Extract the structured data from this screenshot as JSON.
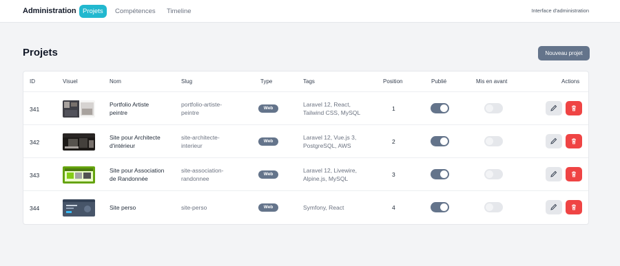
{
  "nav": {
    "brand": "Administration",
    "links": [
      "Projets",
      "Compétences",
      "Timeline"
    ],
    "right_label": "Interface d'administration"
  },
  "page": {
    "title": "Projets",
    "new_button": "Nouveau projet"
  },
  "colors": {
    "accent": "#22b8cf",
    "slate": "#64748b",
    "danger": "#ef4444"
  },
  "table": {
    "headers": [
      "ID",
      "Visuel",
      "Nom",
      "Slug",
      "Type",
      "Tags",
      "Position",
      "Publié",
      "Mis en avant",
      "Actions"
    ],
    "rows": [
      {
        "id": "341",
        "name": [
          "Portfolio Artiste",
          "peintre"
        ],
        "slug": [
          "portfolio-artiste-",
          "peintre"
        ],
        "type": "Web",
        "tags": [
          "Laravel 12, React,",
          "Tailwind CSS, MySQL"
        ],
        "position": "1",
        "published": true,
        "featured": false,
        "thumb": "gallery"
      },
      {
        "id": "342",
        "name": [
          "Site pour Architecte",
          "d'intérieur"
        ],
        "slug": [
          "site-architecte-",
          "interieur"
        ],
        "type": "Web",
        "tags": [
          "Laravel 12, Vue.js 3,",
          "PostgreSQL, AWS"
        ],
        "position": "2",
        "published": true,
        "featured": false,
        "thumb": "interior"
      },
      {
        "id": "343",
        "name": [
          "Site pour Association",
          "de Randonnée"
        ],
        "slug": [
          "site-association-",
          "randonnee"
        ],
        "type": "Web",
        "tags": [
          "Laravel 12, Livewire,",
          "Alpine.js, MySQL"
        ],
        "position": "3",
        "published": true,
        "featured": false,
        "thumb": "green"
      },
      {
        "id": "344",
        "name": [
          "Site perso"
        ],
        "slug": [
          "site-perso"
        ],
        "type": "Web",
        "tags": [
          "Symfony, React"
        ],
        "position": "4",
        "published": true,
        "featured": false,
        "thumb": "blue"
      }
    ]
  }
}
